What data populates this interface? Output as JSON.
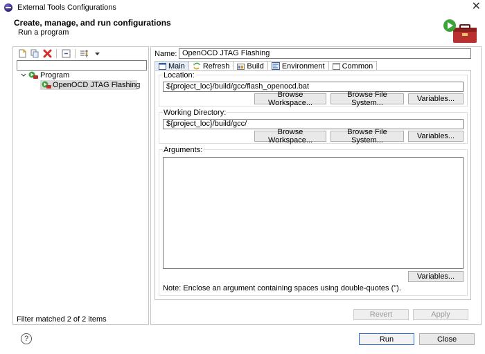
{
  "window": {
    "title": "External Tools Configurations",
    "close_glyph": "✕"
  },
  "banner": {
    "title": "Create, manage, and run configurations",
    "subtitle": "Run a program"
  },
  "sidebar": {
    "toolbar": [
      "new-config-icon",
      "duplicate-icon",
      "delete-icon",
      "collapse-all-icon",
      "filter-icon",
      "view-menu-icon"
    ],
    "filter_value": "",
    "tree": {
      "category": "Program",
      "items": [
        {
          "label": "OpenOCD JTAG Flashing",
          "selected": true
        }
      ]
    },
    "status": "Filter matched 2 of 2 items"
  },
  "config": {
    "name_label": "Name:",
    "name_value": "OpenOCD JTAG Flashing",
    "tabs": [
      {
        "label": "Main",
        "active": true
      },
      {
        "label": "Refresh"
      },
      {
        "label": "Build"
      },
      {
        "label": "Environment"
      },
      {
        "label": "Common"
      }
    ],
    "location": {
      "label": "Location:",
      "value": "${project_loc}/build/gcc/flash_openocd.bat",
      "buttons": [
        "Browse Workspace...",
        "Browse File System...",
        "Variables..."
      ]
    },
    "working_dir": {
      "label": "Working Directory:",
      "value": "${project_loc}/build/gcc/",
      "buttons": [
        "Browse Workspace...",
        "Browse File System...",
        "Variables..."
      ]
    },
    "arguments": {
      "label": "Arguments:",
      "value": "",
      "variables_button": "Variables...",
      "note": "Note: Enclose an argument containing spaces using double-quotes (\")."
    },
    "revert_button": "Revert",
    "apply_button": "Apply"
  },
  "footer": {
    "help_glyph": "?",
    "run_button": "Run",
    "close_button": "Close"
  },
  "colors": {
    "accent": "#2a6fd6",
    "delete_red": "#d22b2b",
    "selection": "#d9d9d9"
  }
}
